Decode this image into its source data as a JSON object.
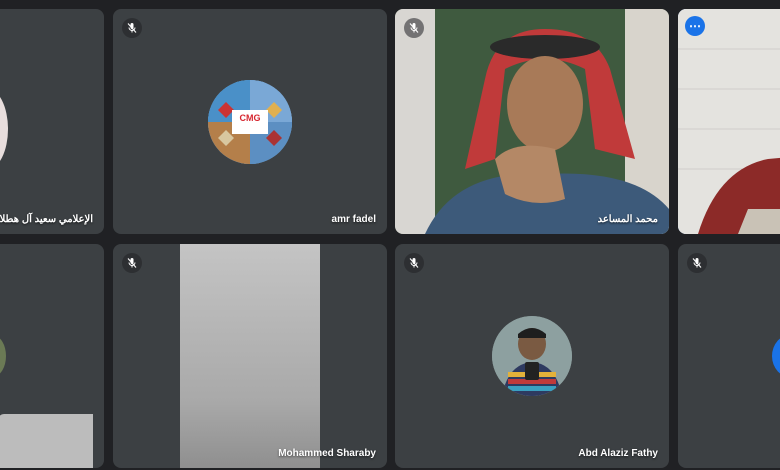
{
  "participants": [
    {
      "name": "الإعلامي سعيد آل هطلاء",
      "muted": false
    },
    {
      "name": "amr fadel",
      "muted": true
    },
    {
      "name": "محمد المساعد",
      "muted": true
    },
    {
      "name": "",
      "muted": false,
      "active_speaker": true
    },
    {
      "name": "",
      "muted": true
    },
    {
      "name": "Mohammed Sharaby",
      "muted": true
    },
    {
      "name": "Abd Alaziz Fathy",
      "muted": true
    },
    {
      "name": "",
      "muted": true
    }
  ],
  "avatars": {
    "amr_fadel_logo_text": "CMG"
  },
  "icons": {
    "mic_off": "mic-off-icon",
    "more_options": "more-vert-icon"
  },
  "colors": {
    "background": "#202124",
    "tile": "#3c4043",
    "active_border": "#8ab4f8",
    "accent": "#1a73e8",
    "logo_red": "#d7262f"
  }
}
